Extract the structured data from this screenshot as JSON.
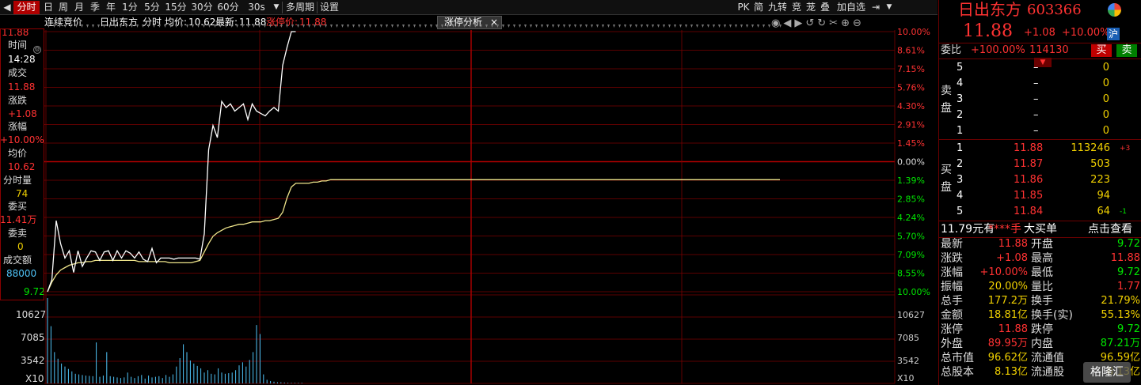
{
  "toolbar": {
    "menu_icon": "left-arrow-icon",
    "tabs": [
      "分时",
      "日",
      "周",
      "月",
      "季",
      "年",
      "1分",
      "5分",
      "15分",
      "30分",
      "60分",
      "30s",
      "多周期",
      "设置"
    ],
    "active_tab": "分时",
    "right_items": [
      "PK",
      "简",
      "九转",
      "竞",
      "茏",
      "叠",
      "加自选"
    ],
    "right_icon": "sidebar-toggle-icon"
  },
  "infobar": {
    "mode": "连续竞价",
    "stock_name": "日出东方",
    "period": "分时",
    "avg_label": "均价:",
    "avg_value": "10.62",
    "latest_label": "最新:",
    "latest_value": "11.88",
    "limit_label": "涨停价:",
    "limit_value": "11.88",
    "analysis_tab": "涨停分析",
    "analysis_close": "×"
  },
  "leftpanel": {
    "price_top": "11.88",
    "time_label": "时间",
    "time_value": "14:28",
    "trade_label": "成交",
    "trade_value": "11.88",
    "change_label": "涨跌",
    "change_value": "+1.08",
    "pct_label": "涨幅",
    "pct_value": "+10.00%",
    "avg_label": "均价",
    "avg_value": "10.62",
    "vol_label": "分时量",
    "vol_value": "74",
    "bid_label": "委买",
    "bid_value": "11.41万",
    "ask_label": "委卖",
    "ask_value": "0",
    "amount_label": "成交额",
    "amount_value": "88000",
    "price_bottom": "9.72",
    "vol_ticks": [
      "10627",
      "7085",
      "3542",
      "X10"
    ]
  },
  "chart_data": {
    "type": "line",
    "title": "",
    "prev_close": 10.8,
    "price_ylim": [
      9.72,
      11.88
    ],
    "right_axis_pct": [
      "10.00%",
      "8.61%",
      "7.15%",
      "5.76%",
      "4.30%",
      "2.91%",
      "1.45%",
      "0.00%",
      "1.39%",
      "2.85%",
      "4.24%",
      "5.70%",
      "7.09%",
      "8.55%",
      "10.00%"
    ],
    "volume_ticks": [
      "10627",
      "7085",
      "3542",
      "X10"
    ],
    "volume_max": 14169,
    "series": [
      {
        "values": [
          9.72,
          9.82,
          10.31,
          10.12,
          10.0,
          10.06,
          9.88,
          10.06,
          9.93,
          10.0,
          10.06,
          10.05,
          9.98,
          10.05,
          10.06,
          9.98,
          10.06,
          10.0,
          10.06,
          10.04,
          10.0,
          10.05,
          9.99,
          9.97,
          10.08,
          9.96,
          10.0,
          10.0,
          10.0,
          9.99,
          10.0,
          10.0,
          10.0,
          10.0,
          10.0,
          9.99,
          10.2,
          10.9,
          11.1,
          11.0,
          11.3,
          11.25,
          11.28,
          11.22,
          11.25,
          11.28,
          11.15,
          11.28,
          11.22,
          11.2,
          11.18,
          11.22,
          11.25,
          11.22,
          11.6,
          11.75,
          11.88,
          11.88
        ]
      },
      {
        "values": [
          9.72,
          9.8,
          9.86,
          9.9,
          9.92,
          9.94,
          9.95,
          9.96,
          9.96,
          9.97,
          9.97,
          9.98,
          9.98,
          9.98,
          9.98,
          9.98,
          9.98,
          9.98,
          9.98,
          9.98,
          9.98,
          9.97,
          9.97,
          9.97,
          9.97,
          9.97,
          9.97,
          9.97,
          9.96,
          9.96,
          9.96,
          9.96,
          9.96,
          9.96,
          9.97,
          9.98,
          10.05,
          10.12,
          10.18,
          10.21,
          10.23,
          10.25,
          10.26,
          10.27,
          10.28,
          10.28,
          10.29,
          10.3,
          10.3,
          10.3,
          10.31,
          10.31,
          10.32,
          10.33,
          10.38,
          10.5,
          10.59,
          10.62,
          10.62,
          10.62,
          10.62,
          10.63,
          10.63,
          10.64,
          10.64,
          10.65,
          10.65
        ]
      }
    ],
    "volume": [
      14169,
      9500,
      5200,
      4100,
      3300,
      2800,
      2400,
      2000,
      1600,
      1500,
      1400,
      1300,
      1250,
      1200,
      6800,
      1100,
      1300,
      5200,
      1200,
      1100,
      1000,
      900,
      1000,
      1800,
      1100,
      900,
      1200,
      1400,
      800,
      1300,
      1000,
      1100,
      1200,
      900,
      1400,
      1100,
      1500,
      2800,
      4200,
      6500,
      5200,
      3800,
      3300,
      2900,
      2500,
      1800,
      2200,
      1600,
      1500,
      2500,
      1800,
      1600,
      1700,
      1800,
      2200,
      3000,
      3500,
      2800,
      3900,
      5200,
      9700,
      8200,
      1500,
      600,
      400,
      300,
      200,
      200,
      150,
      120,
      100,
      100,
      100,
      100
    ]
  },
  "rightpanel": {
    "name": "日出东方",
    "code": "603366",
    "price": "11.88",
    "change": "+1.08",
    "pct": "+10.00%",
    "market_badge": "沪",
    "weibi_label": "委比",
    "weibi_value": "+100.00%",
    "weicha_value": "114130",
    "buy_btn": "买",
    "sell_btn": "卖",
    "sell_label": [
      "卖",
      "盘"
    ],
    "buy_label": [
      "买",
      "盘"
    ],
    "asks": [
      {
        "level": "5",
        "price": "–",
        "vol": "0",
        "chg": ""
      },
      {
        "level": "4",
        "price": "–",
        "vol": "0",
        "chg": ""
      },
      {
        "level": "3",
        "price": "–",
        "vol": "0",
        "chg": ""
      },
      {
        "level": "2",
        "price": "–",
        "vol": "0",
        "chg": ""
      },
      {
        "level": "1",
        "price": "–",
        "vol": "0",
        "chg": ""
      }
    ],
    "bids": [
      {
        "level": "1",
        "price": "11.88",
        "vol": "113246",
        "chg": "+3"
      },
      {
        "level": "2",
        "price": "11.87",
        "vol": "503",
        "chg": ""
      },
      {
        "level": "3",
        "price": "11.86",
        "vol": "223",
        "chg": ""
      },
      {
        "level": "4",
        "price": "11.85",
        "vol": "94",
        "chg": ""
      },
      {
        "level": "5",
        "price": "11.84",
        "vol": "64",
        "chg": "-1"
      }
    ],
    "big_order_price": "11.79元有",
    "big_order_stars": "****手",
    "big_order_label": "大买单",
    "big_order_link": "点击查看",
    "stats": [
      {
        "l1": "最新",
        "v1": "11.88",
        "c1": "red",
        "l2": "开盘",
        "v2": "9.72",
        "c2": "green"
      },
      {
        "l1": "涨跌",
        "v1": "+1.08",
        "c1": "red",
        "l2": "最高",
        "v2": "11.88",
        "c2": "red"
      },
      {
        "l1": "涨幅",
        "v1": "+10.00%",
        "c1": "red",
        "l2": "最低",
        "v2": "9.72",
        "c2": "green"
      },
      {
        "l1": "振幅",
        "v1": "20.00%",
        "c1": "yellow",
        "l2": "量比",
        "v2": "1.77",
        "c2": "red"
      },
      {
        "l1": "总手",
        "v1": "177.2万",
        "c1": "yellow",
        "l2": "换手",
        "v2": "21.79%",
        "c2": "yellow"
      },
      {
        "l1": "金额",
        "v1": "18.81亿",
        "c1": "yellow",
        "l2": "换手(实)",
        "v2": "55.13%",
        "c2": "yellow"
      },
      {
        "l1": "涨停",
        "v1": "11.88",
        "c1": "red",
        "l2": "跌停",
        "v2": "9.72",
        "c2": "green"
      },
      {
        "l1": "外盘",
        "v1": "89.95万",
        "c1": "red",
        "l2": "内盘",
        "v2": "87.21万",
        "c2": "green"
      },
      {
        "l1": "总市值",
        "v1": "96.62亿",
        "c1": "yellow",
        "l2": "流通值",
        "v2": "96.59亿",
        "c2": "yellow"
      },
      {
        "l1": "总股本",
        "v1": "8.13亿",
        "c1": "yellow",
        "l2": "流通股",
        "v2": "8.13亿",
        "c2": "yellow"
      }
    ],
    "watermark": "格隆汇"
  },
  "colors": {
    "up": "#ff3232",
    "down": "#00e600",
    "price_line": "#ffffff",
    "avg_line": "#f0e68c",
    "grid": "#7a0000",
    "volume": "#4fc3f7"
  }
}
